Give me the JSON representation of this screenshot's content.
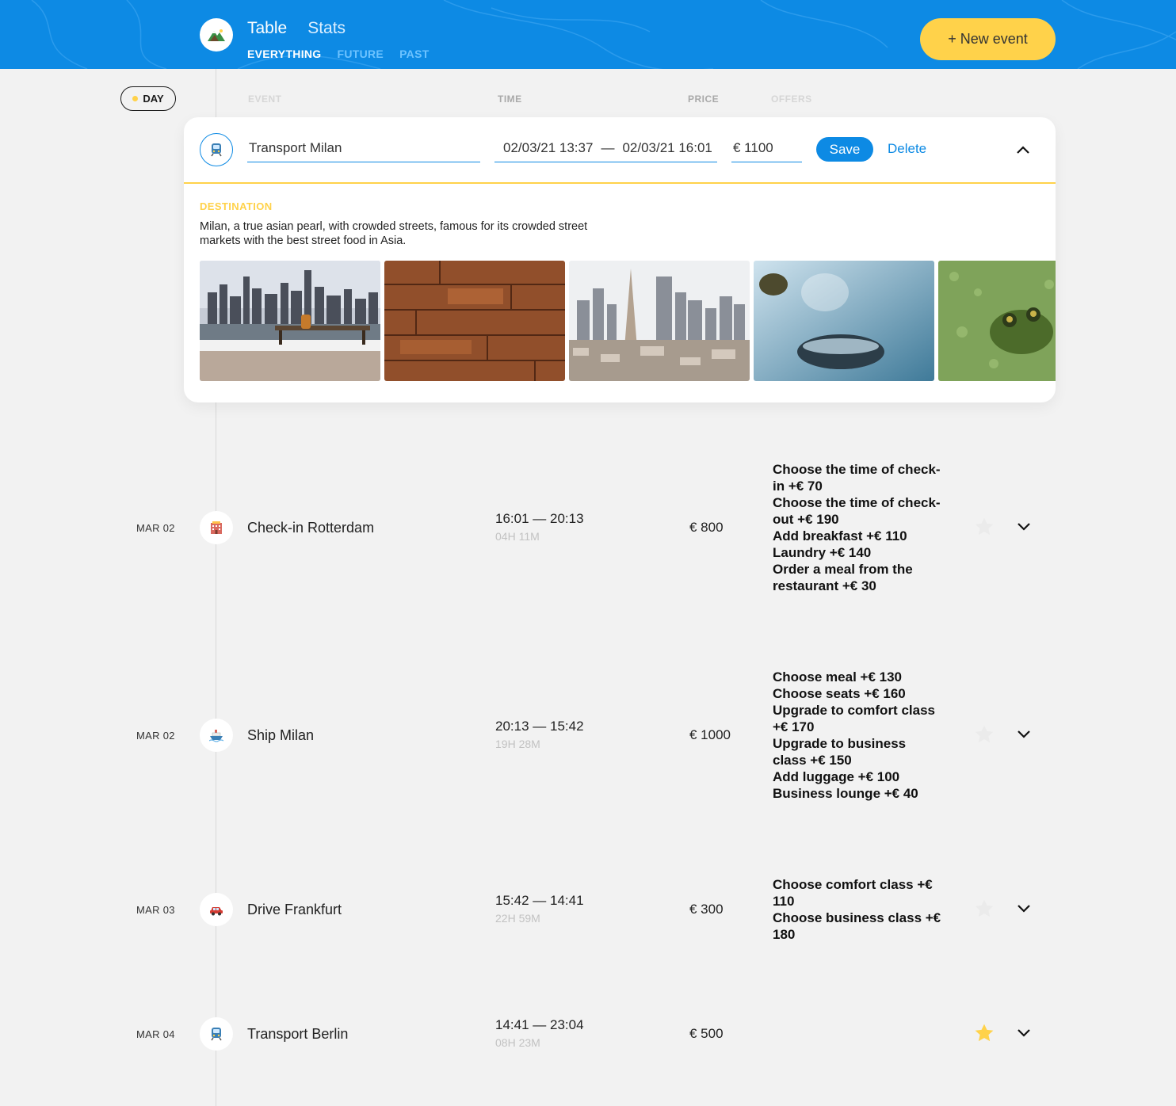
{
  "header": {
    "tabs": [
      "Table",
      "Stats"
    ],
    "filters": [
      "EVERYTHING",
      "FUTURE",
      "PAST"
    ],
    "new_event_label": "+ New event",
    "logo_icon": "mountain-icon"
  },
  "colors": {
    "brand_blue": "#0d8ae4",
    "accent_yellow": "#ffd24a",
    "background": "#f2f2f2"
  },
  "sort": {
    "day_label": "DAY",
    "event_label": "EVENT",
    "time_label": "TIME",
    "price_label": "PRICE",
    "offers_label": "OFFERS"
  },
  "edit_form": {
    "type_icon": "train-icon",
    "destination_value": "Transport Milan",
    "start_time": "02/03/21 13:37",
    "time_separator": "—",
    "end_time": "02/03/21 16:01",
    "price_value": "€ 1100",
    "save_label": "Save",
    "delete_label": "Delete",
    "destination_heading": "DESTINATION",
    "destination_description": "Milan, a true asian pearl, with crowded streets, famous for its crowded street markets with the best street food in Asia.",
    "photos": [
      "city-skyline-with-bench",
      "wooden-planks",
      "city-aerial-view",
      "steaming-cup",
      "frog-in-pond"
    ]
  },
  "events": [
    {
      "date": "MAR 02",
      "icon": "hotel-icon",
      "title": "Check-in Rotterdam",
      "time_range": "16:01 — 20:13",
      "duration": "04H 11M",
      "price": "€ 800",
      "offers": [
        "Choose the time of check-in +€  70",
        "Choose the time of check-out +€  190",
        "Add breakfast +€  110",
        "Laundry +€  140",
        "Order a meal from the restaurant +€  30"
      ],
      "favorite": false
    },
    {
      "date": "MAR 02",
      "icon": "ship-icon",
      "title": "Ship Milan",
      "time_range": "20:13 — 15:42",
      "duration": "19H 28M",
      "price": "€ 1000",
      "offers": [
        "Choose meal +€  130",
        "Choose seats +€  160",
        "Upgrade to comfort class +€  170",
        "Upgrade to business class +€  150",
        "Add luggage +€  100",
        "Business lounge +€  40"
      ],
      "favorite": false
    },
    {
      "date": "MAR 03",
      "icon": "car-icon",
      "title": "Drive Frankfurt",
      "time_range": "15:42 — 14:41",
      "duration": "22H 59M",
      "price": "€ 300",
      "offers": [
        "Choose comfort class +€  110",
        "Choose business class +€  180"
      ],
      "favorite": false
    },
    {
      "date": "MAR 04",
      "icon": "train-icon",
      "title": "Transport Berlin",
      "time_range": "14:41 — 23:04",
      "duration": "08H 23M",
      "price": "€ 500",
      "offers": [],
      "favorite": true
    }
  ]
}
